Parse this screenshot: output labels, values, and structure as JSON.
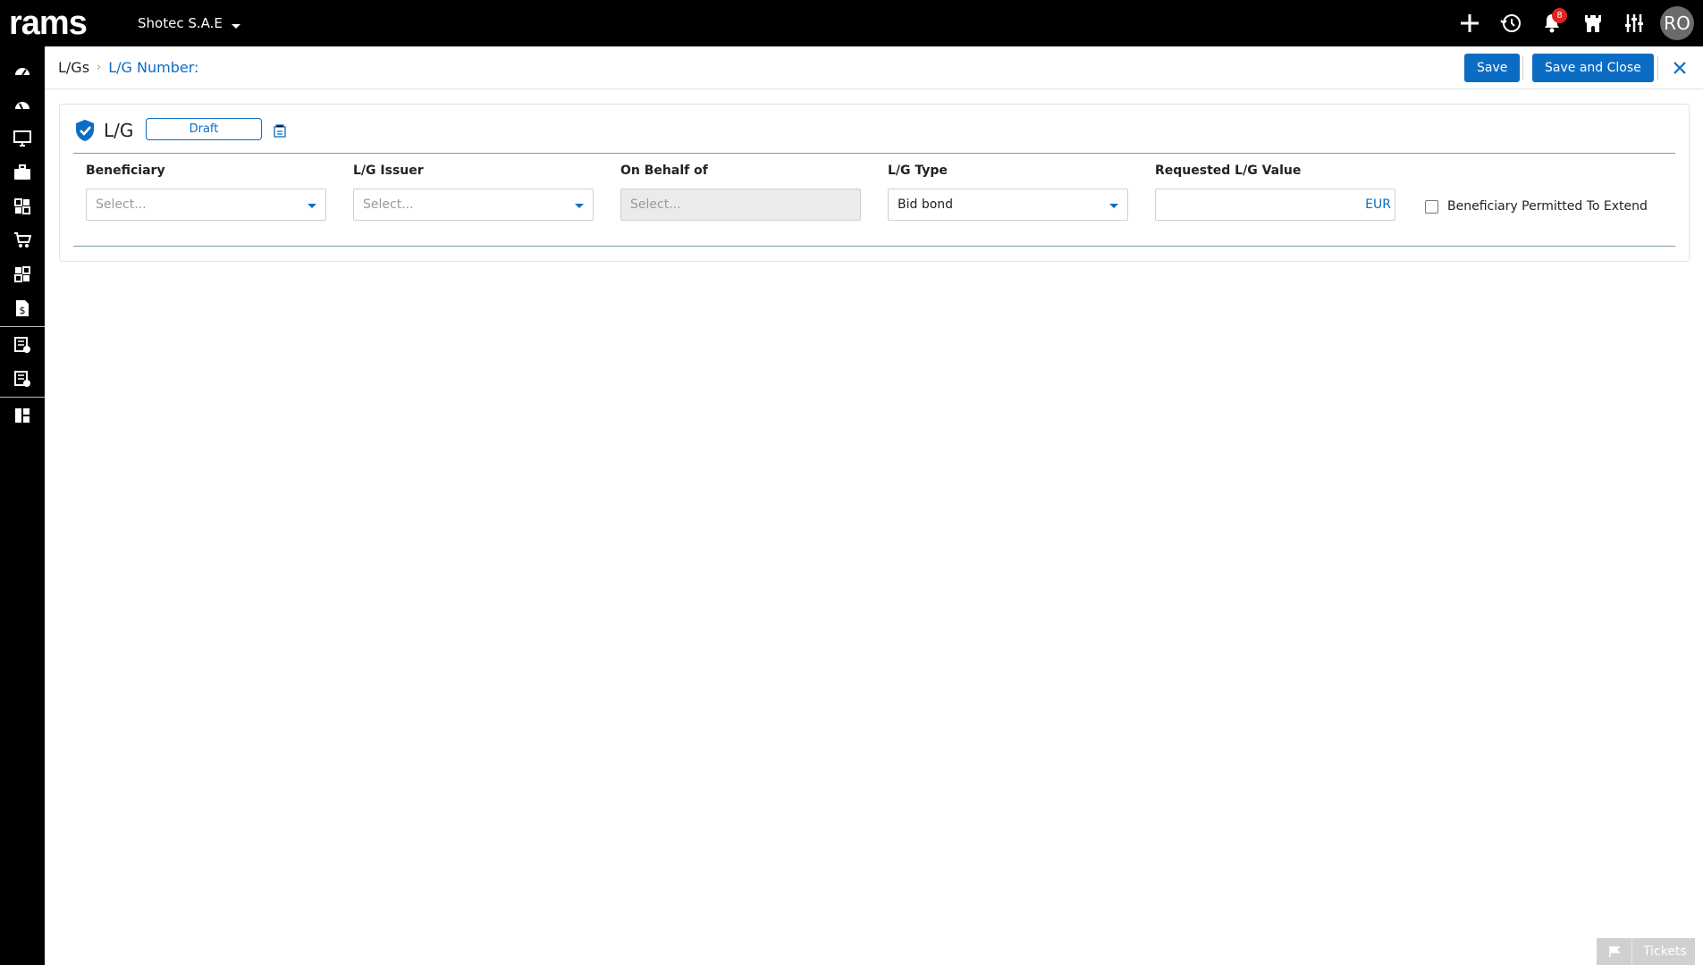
{
  "app": {
    "logo_text": "rams",
    "company": "Shotec S.A.E",
    "notifications_count": "8",
    "user_initials": "RO"
  },
  "topbar_icons": [
    "add-icon",
    "history-icon",
    "bell-icon",
    "castle-icon",
    "sliders-icon"
  ],
  "sidebar_icons": [
    "dashboard-icon",
    "dashboard-alt-icon",
    "monitor-icon",
    "briefcase-icon",
    "modules-icon",
    "cart-icon",
    "modules-alt-icon",
    "money-document-icon",
    "document-check-icon",
    "document-clock-icon",
    "columns-icon"
  ],
  "breadcrumb": {
    "root": "L/Gs",
    "current": "L/G Number:"
  },
  "actions": {
    "save": "Save",
    "save_and_close": "Save and Close"
  },
  "card": {
    "title": "L/G",
    "status": "Draft"
  },
  "form": {
    "beneficiary": {
      "label": "Beneficiary",
      "placeholder": "Select..."
    },
    "issuer": {
      "label": "L/G Issuer",
      "placeholder": "Select..."
    },
    "on_behalf_of": {
      "label": "On Behalf of",
      "placeholder": "Select..."
    },
    "lg_type": {
      "label": "L/G Type",
      "value": "Bid bond"
    },
    "requested_value": {
      "label": "Requested L/G Value",
      "value": "",
      "currency": "EUR"
    },
    "permitted_to_extend": {
      "label": "Beneficiary Permitted To Extend",
      "checked": false
    }
  },
  "tickets": {
    "label": "Tickets"
  },
  "colors": {
    "accent": "#0b6cc4",
    "topbar": "#000000",
    "badge": "#e02424"
  }
}
